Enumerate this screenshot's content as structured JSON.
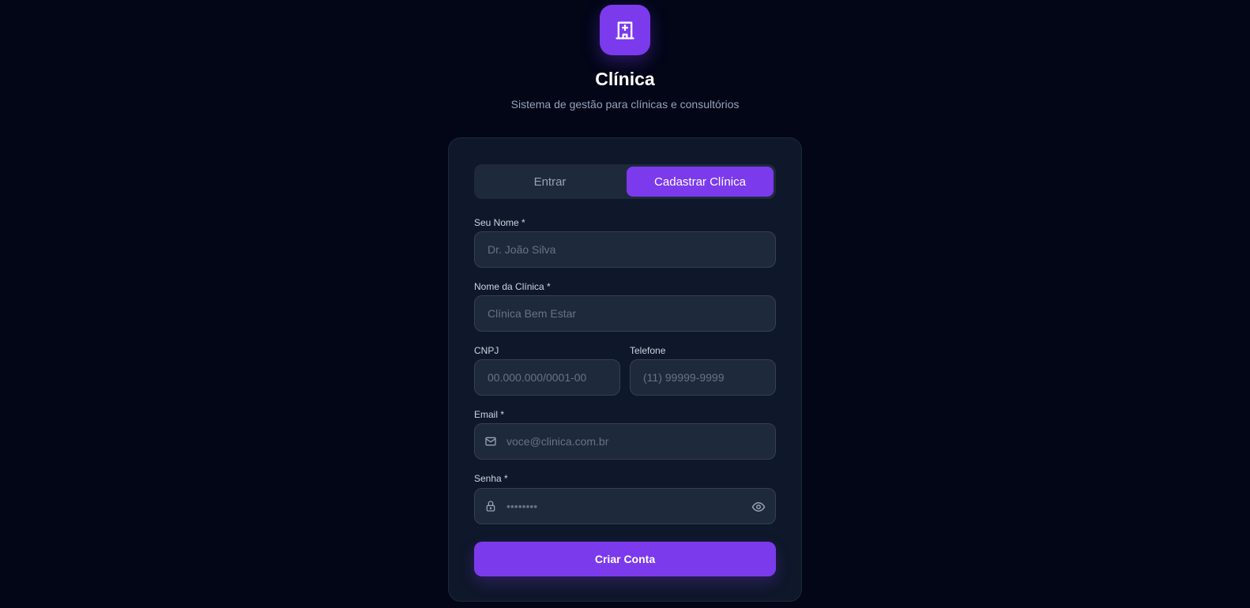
{
  "brand": {
    "logo_icon": "hospital-icon",
    "title": "Clínica",
    "subtitle": "Sistema de gestão para clínicas e consultórios",
    "accent_color": "#7c3aed"
  },
  "tabs": [
    {
      "label": "Entrar",
      "active": false
    },
    {
      "label": "Cadastrar Clínica",
      "active": true
    }
  ],
  "form": {
    "name": {
      "label": "Seu Nome *",
      "placeholder": "Dr. João Silva",
      "value": ""
    },
    "clinic_name": {
      "label": "Nome da Clínica *",
      "placeholder": "Clínica Bem Estar",
      "value": ""
    },
    "cnpj": {
      "label": "CNPJ",
      "placeholder": "00.000.000/0001-00",
      "value": ""
    },
    "phone": {
      "label": "Telefone",
      "placeholder": "(11) 99999-9999",
      "value": ""
    },
    "email": {
      "label": "Email *",
      "placeholder": "voce@clinica.com.br",
      "value": "",
      "icon": "mail-icon"
    },
    "password": {
      "label": "Senha *",
      "placeholder": "••••••••",
      "value": "",
      "icon": "lock-icon",
      "toggle_icon": "eye-icon"
    },
    "submit_label": "Criar Conta"
  }
}
